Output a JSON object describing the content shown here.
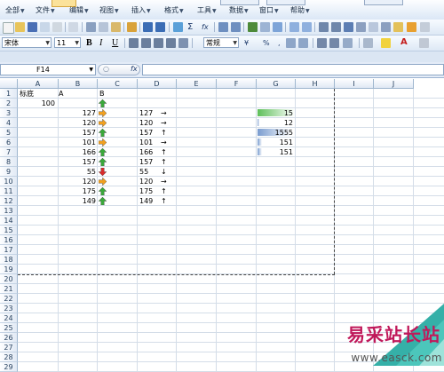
{
  "menubar": {
    "items": [
      {
        "label": "全部",
        "dropdown": true
      },
      {
        "label": "文件",
        "dropdown": true
      },
      {
        "label": "编辑",
        "dropdown": true
      },
      {
        "label": "视图",
        "dropdown": true
      },
      {
        "label": "插入",
        "dropdown": true
      },
      {
        "label": "格式",
        "dropdown": true
      },
      {
        "label": "工具",
        "dropdown": true
      },
      {
        "label": "数据",
        "dropdown": true
      },
      {
        "label": "窗口",
        "dropdown": true
      },
      {
        "label": "帮助",
        "dropdown": true
      }
    ]
  },
  "toolbar": {
    "font_name": "宋体",
    "font_size": "11",
    "number_format": "常规",
    "bold_label": "B",
    "italic_label": "I",
    "underline_label": "U",
    "currency_label": "¥",
    "percent_label": "%",
    "comma_label": ",",
    "sum_label": "Σ",
    "fx_label": "fx"
  },
  "formula_bar": {
    "name_box": "F14",
    "fx_label": "fx",
    "formula": ""
  },
  "sheet": {
    "columns": [
      "A",
      "B",
      "C",
      "D",
      "E",
      "F",
      "G",
      "H",
      "I",
      "J"
    ],
    "rows": [
      "1",
      "2",
      "3",
      "4",
      "5",
      "6",
      "7",
      "8",
      "9",
      "10",
      "11",
      "12",
      "13",
      "14",
      "15",
      "16",
      "17",
      "18",
      "19",
      "20",
      "21",
      "22",
      "23",
      "24",
      "25",
      "26",
      "27",
      "28",
      "29"
    ],
    "header_row": {
      "a1": "标底",
      "a1_b": "A",
      "b1": "B"
    },
    "a2_value": "100",
    "data_rows": [
      {
        "row": "3",
        "b": "127",
        "c_icon": "arrow-right-icon",
        "d": "127",
        "d_arrow": "→"
      },
      {
        "row": "4",
        "b": "120",
        "c_icon": "arrow-right-icon",
        "d": "120",
        "d_arrow": "→"
      },
      {
        "row": "5",
        "b": "157",
        "c_icon": "arrow-up-icon",
        "d": "157",
        "d_arrow": "↑"
      },
      {
        "row": "6",
        "b": "101",
        "c_icon": "arrow-right-icon",
        "d": "101",
        "d_arrow": "→"
      },
      {
        "row": "7",
        "b": "166",
        "c_icon": "arrow-up-icon",
        "d": "166",
        "d_arrow": "↑"
      },
      {
        "row": "8",
        "b": "157",
        "c_icon": "arrow-up-icon",
        "d": "157",
        "d_arrow": "↑"
      },
      {
        "row": "9",
        "b": "55",
        "c_icon": "arrow-down-icon",
        "d": "55",
        "d_arrow": "↓"
      },
      {
        "row": "10",
        "b": "120",
        "c_icon": "arrow-right-icon",
        "d": "120",
        "d_arrow": "→"
      },
      {
        "row": "11",
        "b": "175",
        "c_icon": "arrow-up-icon",
        "d": "175",
        "d_arrow": "↑"
      },
      {
        "row": "12",
        "b": "149",
        "c_icon": "arrow-up-icon",
        "d": "149",
        "d_arrow": "↑"
      }
    ],
    "data_bars": [
      {
        "row": "3",
        "value": "15",
        "fill": 1.0,
        "color": "#5fbf5a"
      },
      {
        "row": "4",
        "value": "12",
        "fill": 0.05,
        "color": "#7a9ccf"
      },
      {
        "row": "5",
        "value": "1555",
        "fill": 0.9,
        "color": "#7a9ccf"
      },
      {
        "row": "6",
        "value": "151",
        "fill": 0.12,
        "color": "#7a9ccf"
      },
      {
        "row": "7",
        "value": "151",
        "fill": 0.12,
        "color": "#7a9ccf"
      }
    ],
    "arrow_colors": {
      "up": "#3aa83a",
      "right": "#f0a020",
      "down": "#d82b2b"
    }
  },
  "watermark": {
    "brand": "易采站长站",
    "url": "www.easck.com"
  }
}
